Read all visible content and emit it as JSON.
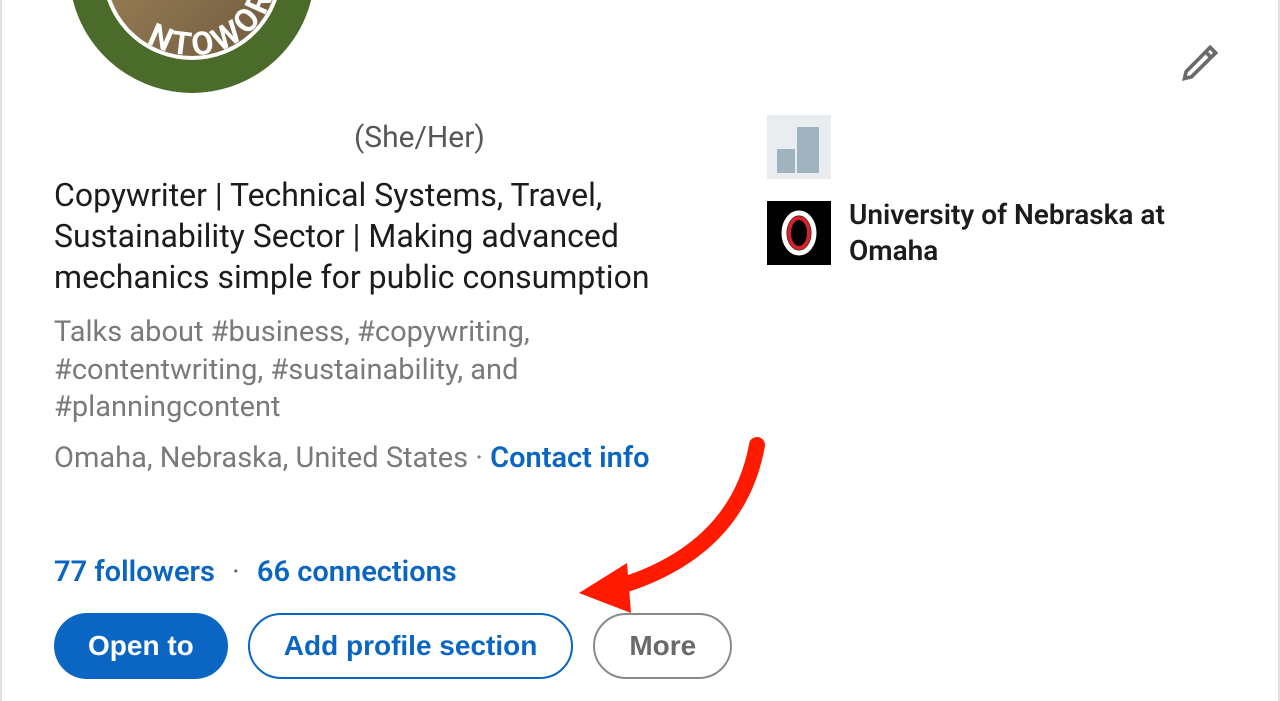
{
  "avatar": {
    "ring_text": "NTOWORK"
  },
  "profile": {
    "pronouns": "(She/Her)",
    "headline": "Copywriter | Technical Systems, Travel, Sustainability Sector | Making advanced mechanics simple for public consumption",
    "talks_about": "Talks about #business, #copywriting, #contentwriting, #sustainability, and #planningcontent",
    "location": "Omaha, Nebraska, United States",
    "contact_label": "Contact info",
    "followers_label": "77 followers",
    "connections_label": "66 connections"
  },
  "buttons": {
    "open_to": "Open to",
    "add_section": "Add profile section",
    "more": "More"
  },
  "education": {
    "school_name": "University of Nebraska at Omaha"
  }
}
